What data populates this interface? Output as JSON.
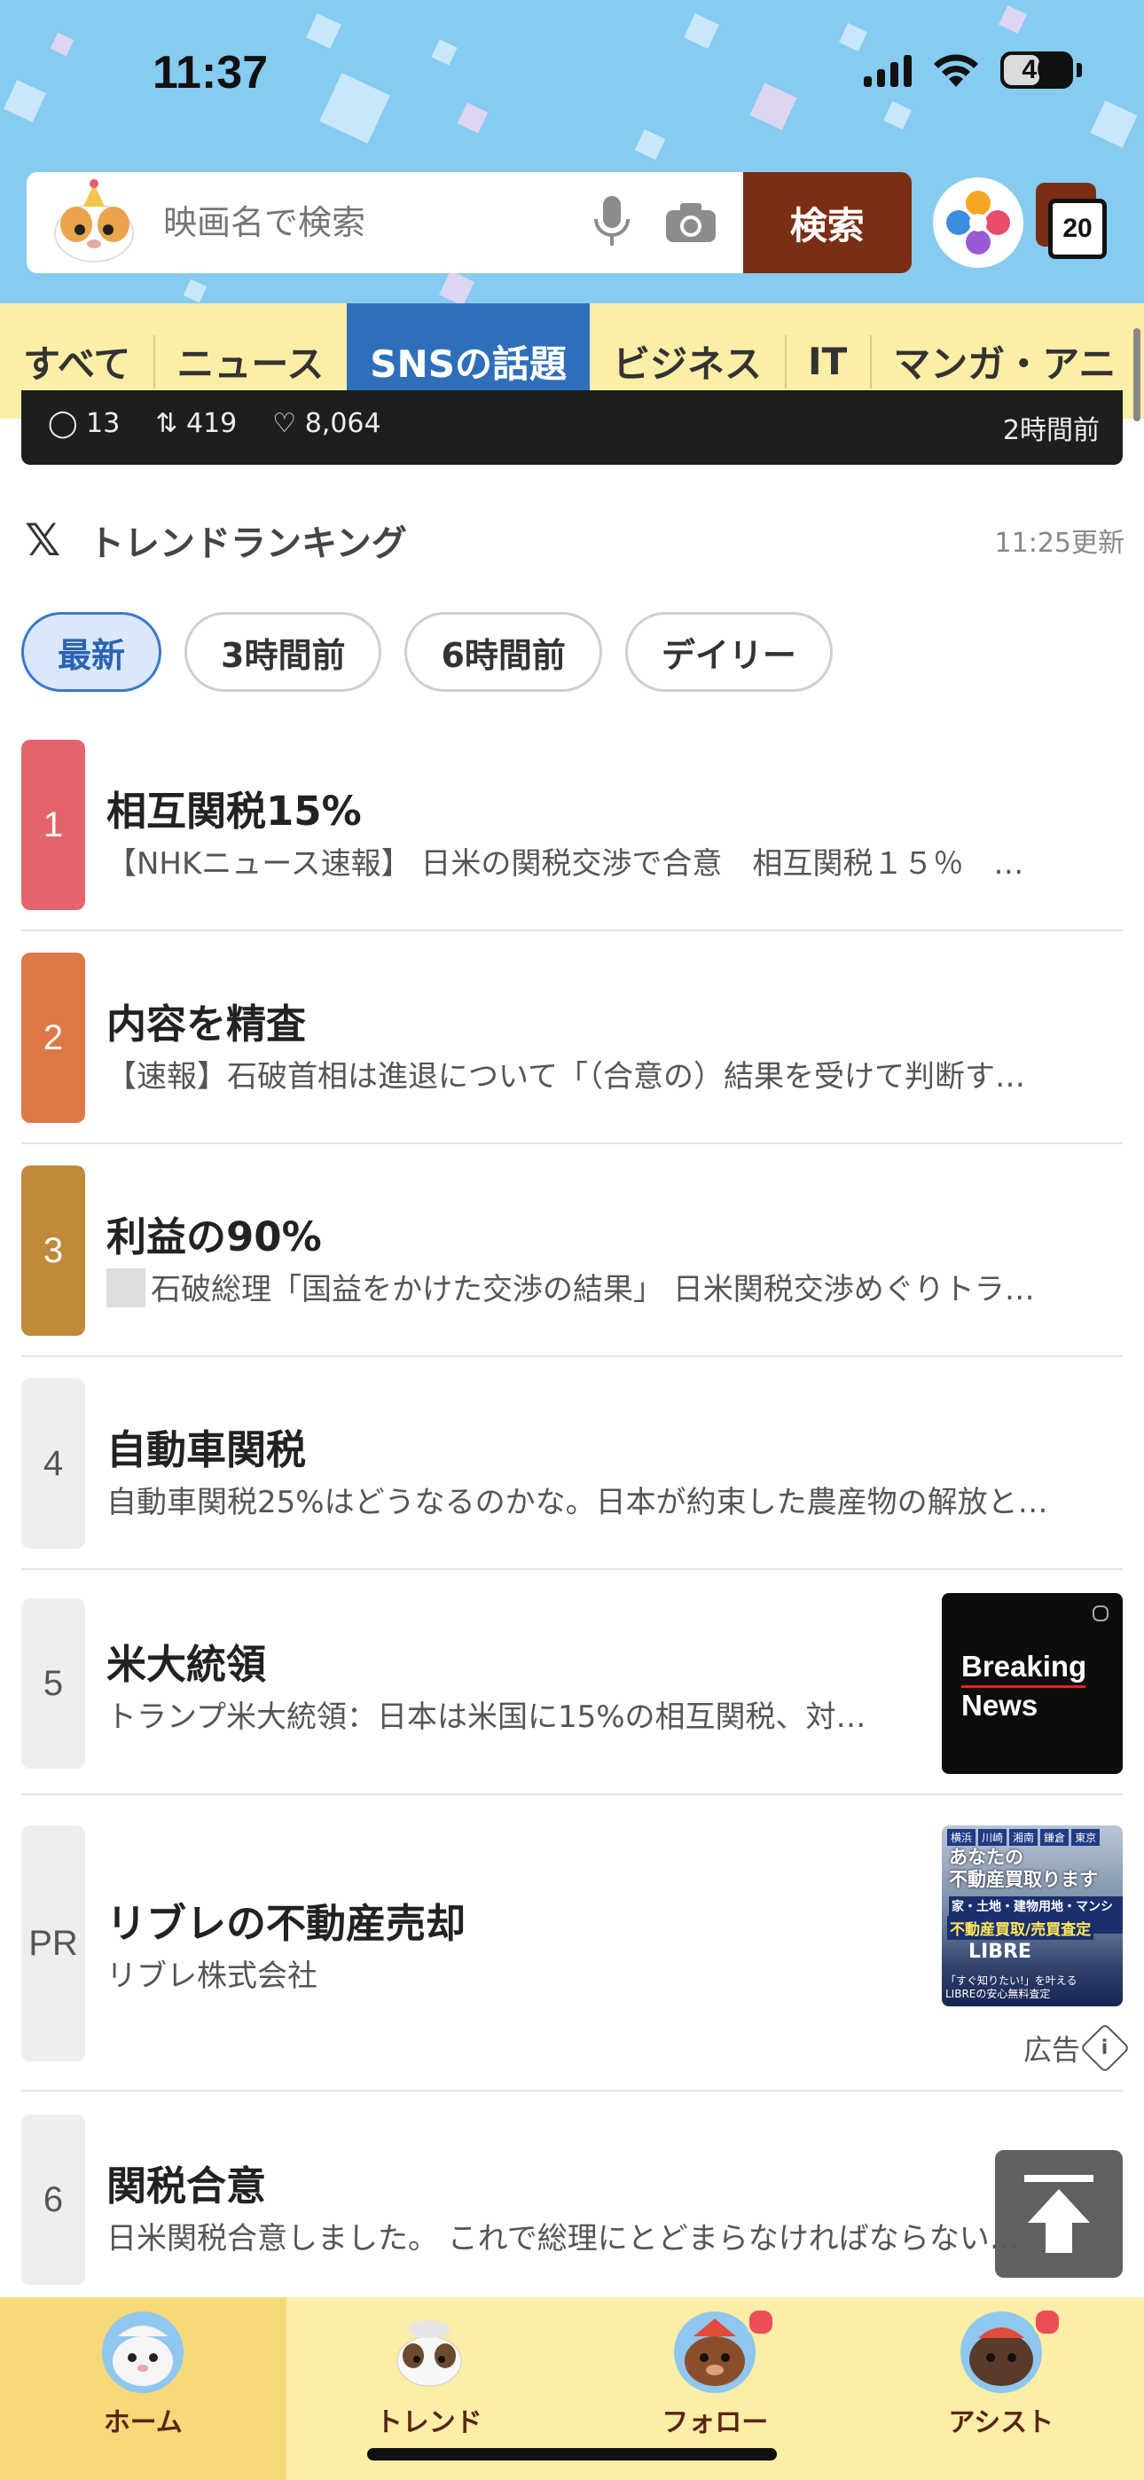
{
  "status": {
    "time": "11:37",
    "battery": "40"
  },
  "search": {
    "placeholder": "映画名で検索",
    "button": "検索",
    "tab_count": "20"
  },
  "categories": [
    {
      "label": "すべて",
      "active": false
    },
    {
      "label": "ニュース",
      "active": false
    },
    {
      "label": "SNSの話題",
      "active": true
    },
    {
      "label": "ビジネス",
      "active": false
    },
    {
      "label": "IT",
      "active": false
    },
    {
      "label": "マンガ・アニ",
      "active": false
    }
  ],
  "previous_card": {
    "comments": "13",
    "reposts": "419",
    "likes": "8,064",
    "time": "2時間前"
  },
  "trend": {
    "title": "トレンドランキング",
    "updated": "11:25更新"
  },
  "filters": [
    "最新",
    "3時間前",
    "6時間前",
    "デイリー"
  ],
  "ranking": [
    {
      "rank": "1",
      "title": "相互関税15%",
      "desc": "【NHKニュース速報】 日米の関税交渉で合意　相互関税１５％　…",
      "color": "#e4646c"
    },
    {
      "rank": "2",
      "title": "内容を精査",
      "desc": "【速報】石破首相は進退について「（合意の）結果を受けて判断す…",
      "color": "#df7847"
    },
    {
      "rank": "3",
      "title": "利益の90%",
      "desc": "石破総理「国益をかけた交渉の結果」 日米関税交渉めぐりトラ…",
      "color": "#c08a3a"
    },
    {
      "rank": "4",
      "title": "自動車関税",
      "desc": "自動車関税25%はどうなるのかな。日本が約束した農産物の解放と…",
      "color": "#eeeeee"
    },
    {
      "rank": "5",
      "title": "米大統領",
      "desc": "トランプ米大統領：日本は米国に15%の相互関税、対…",
      "color": "#eeeeee",
      "thumb": {
        "line1": "Breaking",
        "line2": "News"
      }
    },
    {
      "rank": "PR",
      "title": "リブレの不動産売却",
      "desc": "リブレ株式会社",
      "color": "#eeeeee",
      "ad_label": "広告",
      "ad_image": {
        "tags": [
          "横浜",
          "川崎",
          "湘南",
          "鎌倉",
          "東京"
        ],
        "headline1": "あなたの",
        "headline2": "不動産買取ります",
        "sub": "家・土地・建物用地・マンション",
        "yellow": "不動産買取/売買査定",
        "brand": "LIBRE",
        "note1": "「すぐ知りたい!」を叶える",
        "note2": "LIBREの安心無料査定"
      }
    },
    {
      "rank": "6",
      "title": "関税合意",
      "desc": "日米関税合意しました。 これで総理にとどまらなければならない…",
      "color": "#eeeeee"
    }
  ],
  "bottom_nav": [
    {
      "label": "ホーム",
      "active": true,
      "dot": false
    },
    {
      "label": "トレンド",
      "active": false,
      "dot": false
    },
    {
      "label": "フォロー",
      "active": false,
      "dot": true
    },
    {
      "label": "アシスト",
      "active": false,
      "dot": true
    }
  ]
}
